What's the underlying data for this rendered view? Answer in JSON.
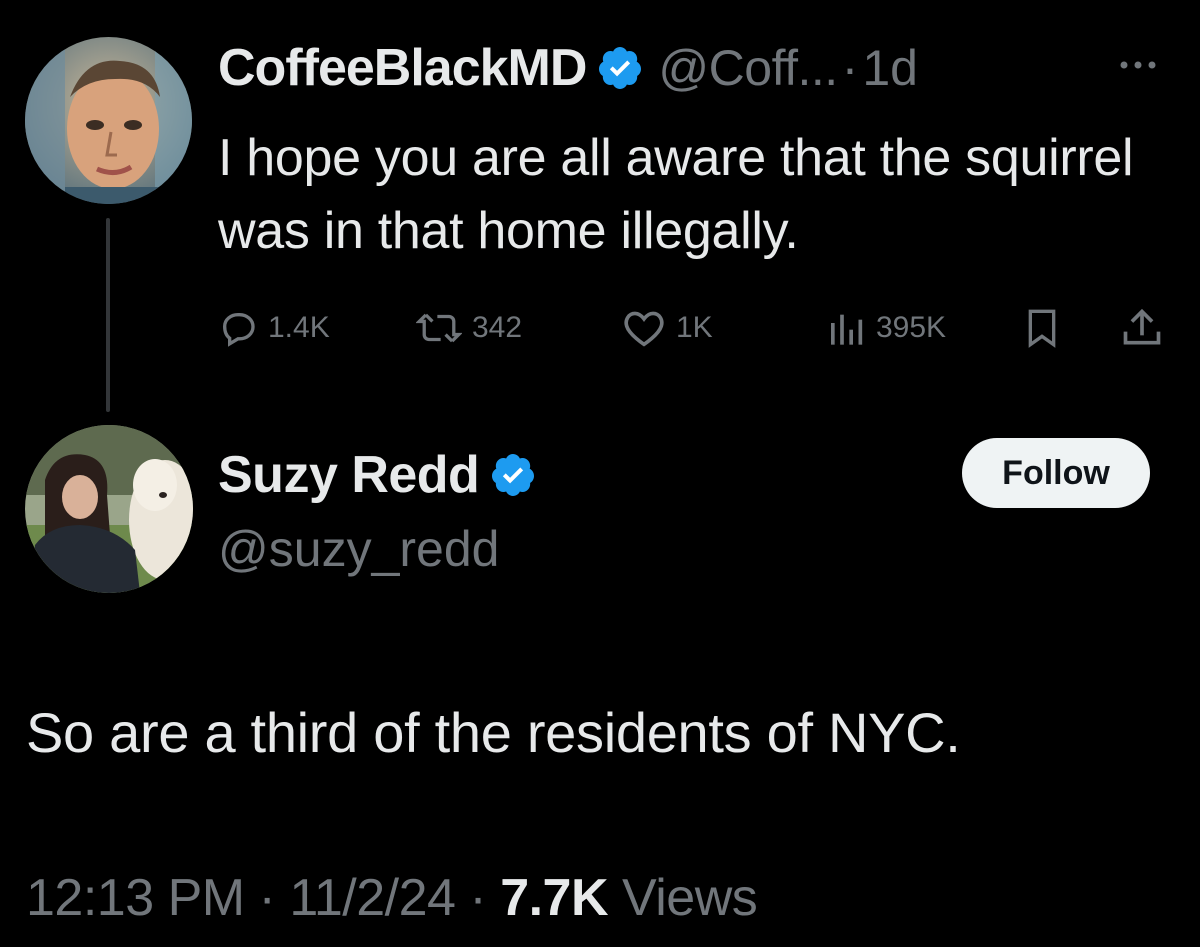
{
  "parent_tweet": {
    "display_name": "CoffeeBlackMD",
    "handle": "@Coff...",
    "separator": "·",
    "time": "1d",
    "text": "I hope you are all aware that the squirrel was in that home illegally.",
    "actions": {
      "replies": "1.4K",
      "reposts": "342",
      "likes": "1K",
      "views": "395K"
    },
    "icons": [
      "reply-icon",
      "repost-icon",
      "like-icon",
      "views-icon",
      "bookmark-icon",
      "share-icon",
      "more-icon",
      "verified-badge-icon"
    ]
  },
  "reply": {
    "display_name": "Suzy Redd",
    "handle": "@suzy_redd",
    "follow_label": "Follow",
    "text": "So are a third of the residents of NYC.",
    "time": "12:13 PM",
    "date": "11/2/24",
    "views_count": "7.7K",
    "views_label": "Views",
    "separator": "·"
  },
  "colors": {
    "background": "#000000",
    "primary_text": "#e7e9ea",
    "secondary_text": "#71767b",
    "verified_blue": "#1d9bf0",
    "follow_bg": "#eff3f4"
  }
}
